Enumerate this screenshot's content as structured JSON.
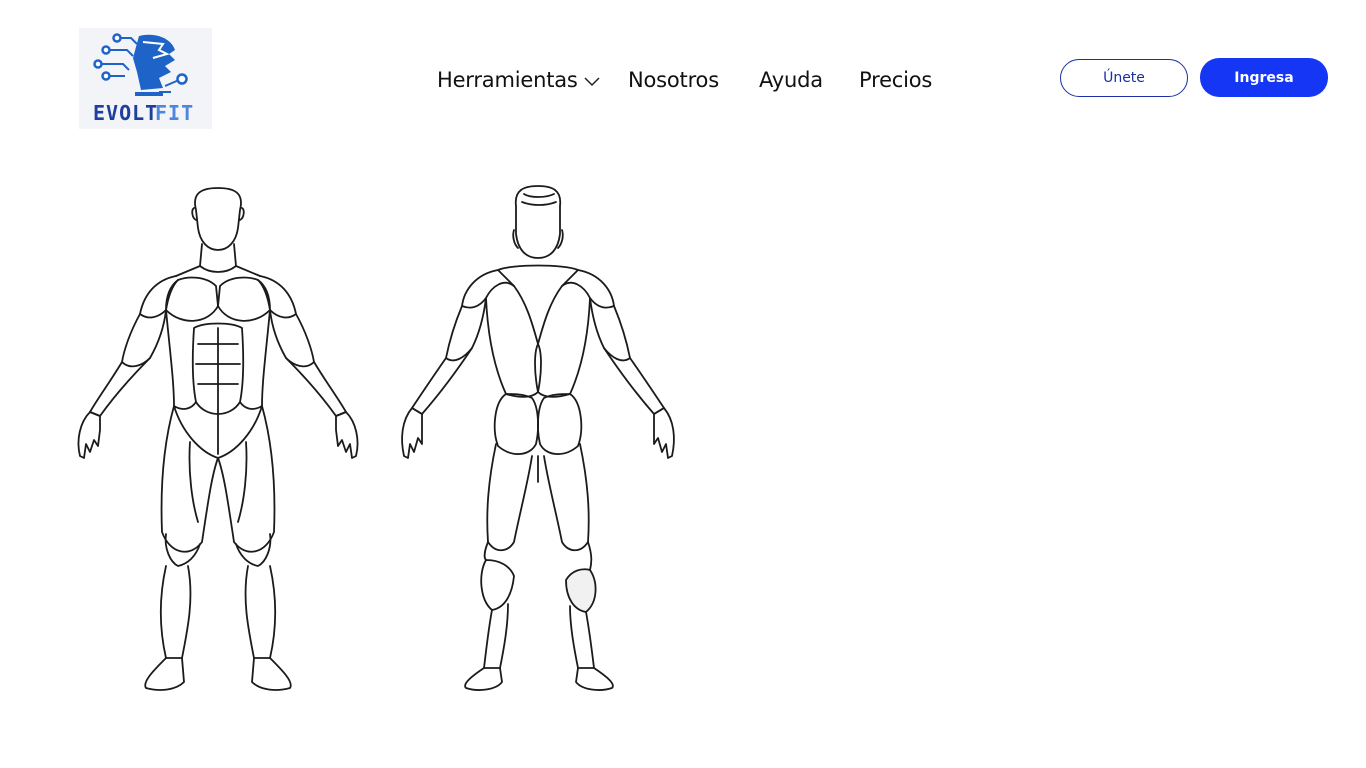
{
  "header": {
    "logo": {
      "alt_text": "EVOLTFIT",
      "icon": "evoltfit-logo"
    },
    "nav": [
      {
        "label": "Herramientas",
        "has_dropdown": true,
        "icon": "chevron-down-icon"
      },
      {
        "label": "Nosotros"
      },
      {
        "label": "Ayuda"
      },
      {
        "label": "Precios"
      }
    ],
    "join_label": "Únete",
    "login_label": "Ingresa"
  },
  "colors": {
    "primary": "#1536f5",
    "outline": "#1a2fa8",
    "logo_blue": "#1e63c8",
    "background": "#ffffff"
  },
  "body_map": {
    "front_view": "front",
    "back_view": "back"
  }
}
